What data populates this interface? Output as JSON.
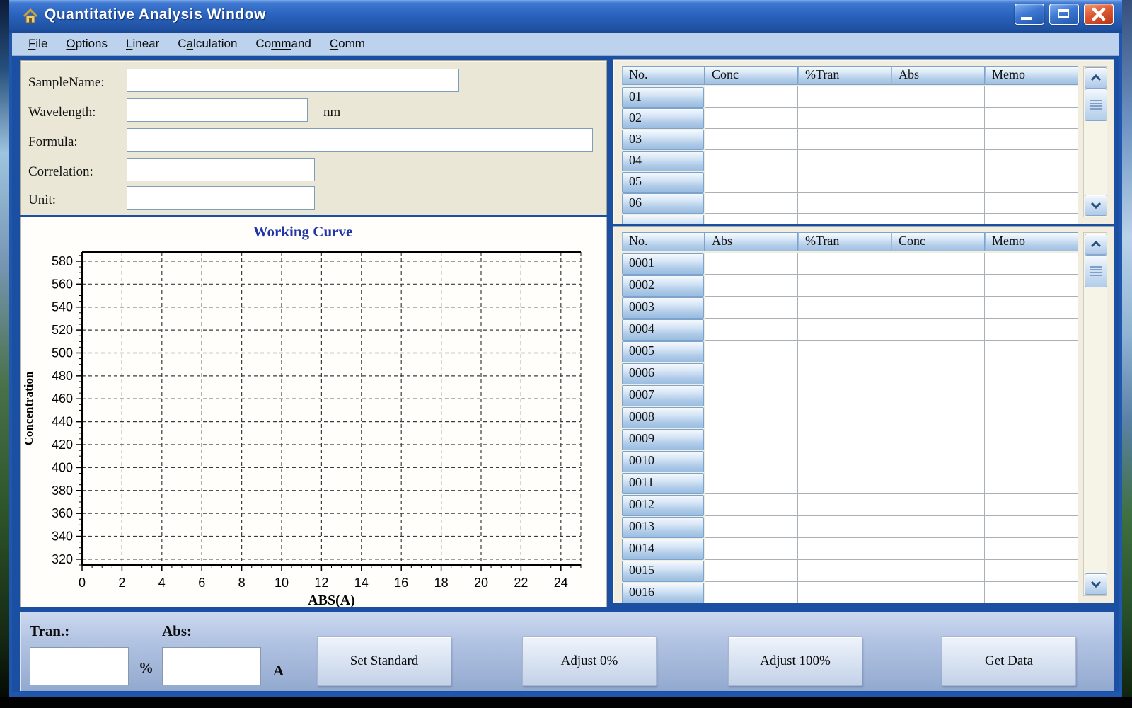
{
  "window": {
    "title": "Quantitative Analysis Window",
    "icon": "home-icon",
    "controls": [
      "minimize",
      "maximize",
      "close"
    ]
  },
  "menu": {
    "items": [
      {
        "pre": "",
        "u": "F",
        "post": "ile"
      },
      {
        "pre": "",
        "u": "O",
        "post": "ptions"
      },
      {
        "pre": "",
        "u": "L",
        "post": "inear"
      },
      {
        "pre": "C",
        "u": "a",
        "post": "lculation"
      },
      {
        "pre": "Co",
        "u": "mm",
        "post": "and"
      },
      {
        "pre": "",
        "u": "C",
        "post": "omm"
      }
    ]
  },
  "form": {
    "fields": [
      {
        "label": "SampleName:",
        "value": "",
        "suffix": ""
      },
      {
        "label": "Wavelength:",
        "value": "",
        "suffix": "nm"
      },
      {
        "label": "Formula:",
        "value": "",
        "suffix": ""
      },
      {
        "label": "Correlation:",
        "value": "",
        "suffix": ""
      },
      {
        "label": "Unit:",
        "value": "",
        "suffix": ""
      }
    ]
  },
  "chart_data": {
    "type": "line",
    "title": "Working Curve",
    "xlabel": "ABS(A)",
    "ylabel": "Concentration",
    "xlim": [
      0,
      25
    ],
    "ylim": [
      315,
      588
    ],
    "x_ticks": [
      0,
      2,
      4,
      6,
      8,
      10,
      12,
      14,
      16,
      18,
      20,
      22,
      24
    ],
    "y_ticks": [
      320,
      340,
      360,
      380,
      400,
      420,
      440,
      460,
      480,
      500,
      520,
      540,
      560,
      580
    ],
    "x_minor_step": 0.5,
    "y_minor_step": 5,
    "grid": "dashed",
    "legend": "none",
    "series": []
  },
  "standard_table": {
    "headers": [
      "No.",
      "Conc",
      "%Tran",
      "Abs",
      "Memo"
    ],
    "rows": [
      "01",
      "02",
      "03",
      "04",
      "05",
      "06",
      ""
    ]
  },
  "sample_table": {
    "headers": [
      "No.",
      "Abs",
      "%Tran",
      "Conc",
      "Memo"
    ],
    "rows": [
      "0001",
      "0002",
      "0003",
      "0004",
      "0005",
      "0006",
      "0007",
      "0008",
      "0009",
      "0010",
      "0011",
      "0012",
      "0013",
      "0014",
      "0015",
      "0016"
    ]
  },
  "bottom_bar": {
    "tran": {
      "label": "Tran.:",
      "value": "",
      "unit": "%"
    },
    "abs": {
      "label": "Abs:",
      "value": "",
      "unit": "A"
    },
    "buttons": [
      "Set Standard",
      "Adjust 0%",
      "Adjust 100%",
      "Get Data"
    ]
  }
}
